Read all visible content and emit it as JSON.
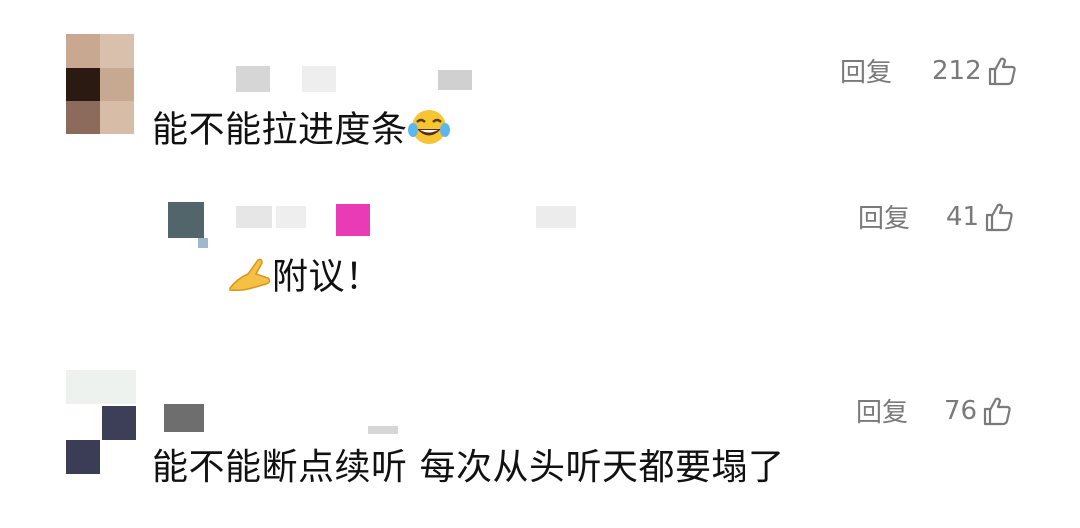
{
  "comments": [
    {
      "text": "能不能拉进度条",
      "reply_label": "回复",
      "like_count": "212",
      "emoji": "tears-of-joy-emoji"
    },
    {
      "text": "附议！",
      "reply_label": "回复",
      "like_count": "41",
      "emoji": "hand-gesture-emoji"
    },
    {
      "text": "能不能断点续听 每次从头听天都要塌了",
      "reply_label": "回复",
      "like_count": "76"
    }
  ],
  "icons": {
    "like": "thumbs-up-outline-icon"
  },
  "colors": {
    "action_gray": "#7a7a7a",
    "text": "#111111",
    "badge_pink": "#e83bb5"
  }
}
